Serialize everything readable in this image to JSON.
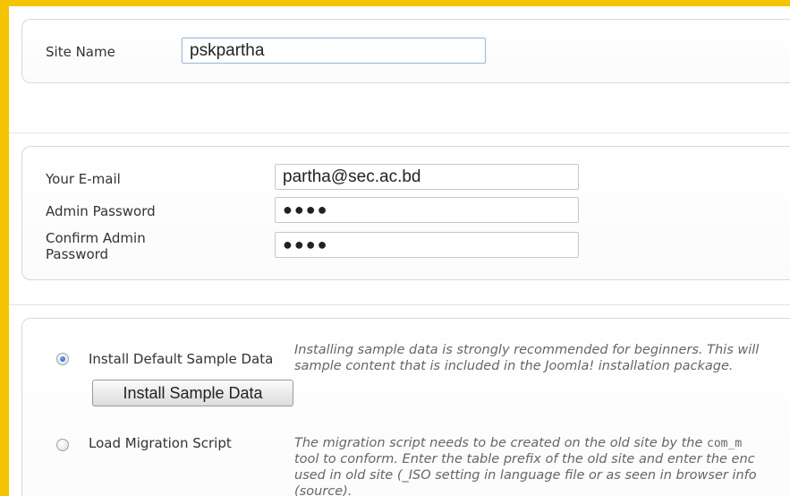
{
  "site": {
    "name_label": "Site Name",
    "name_value": "pskpartha"
  },
  "admin": {
    "email_label": "Your E-mail",
    "email_value": "partha@sec.ac.bd",
    "password_label": "Admin Password",
    "password_value": "●●●●",
    "confirm_label_line1": "Confirm Admin",
    "confirm_label_line2": "Password",
    "confirm_value": "●●●●"
  },
  "sample": {
    "option1_label": "Install Default Sample Data",
    "option1_selected": true,
    "option1_desc_line1": "Installing sample data is strongly recommended for beginners. This will",
    "option1_desc_line2": "sample content that is included in the Joomla! installation package.",
    "install_button": "Install Sample Data",
    "option2_label": "Load Migration Script",
    "option2_selected": false,
    "option2_desc_line1_pre": "The migration script needs to be created on the old site by the ",
    "option2_desc_line1_code": "com_m",
    "option2_desc_line2": "tool to conform. Enter the table prefix of the old site and enter the enc",
    "option2_desc_line3": "used in old site (_ISO setting in language file or as seen in browser info",
    "option2_desc_line4": "(source)."
  },
  "colors": {
    "page_background": "#f5c400",
    "radio_selected": "#1d5fb6"
  }
}
